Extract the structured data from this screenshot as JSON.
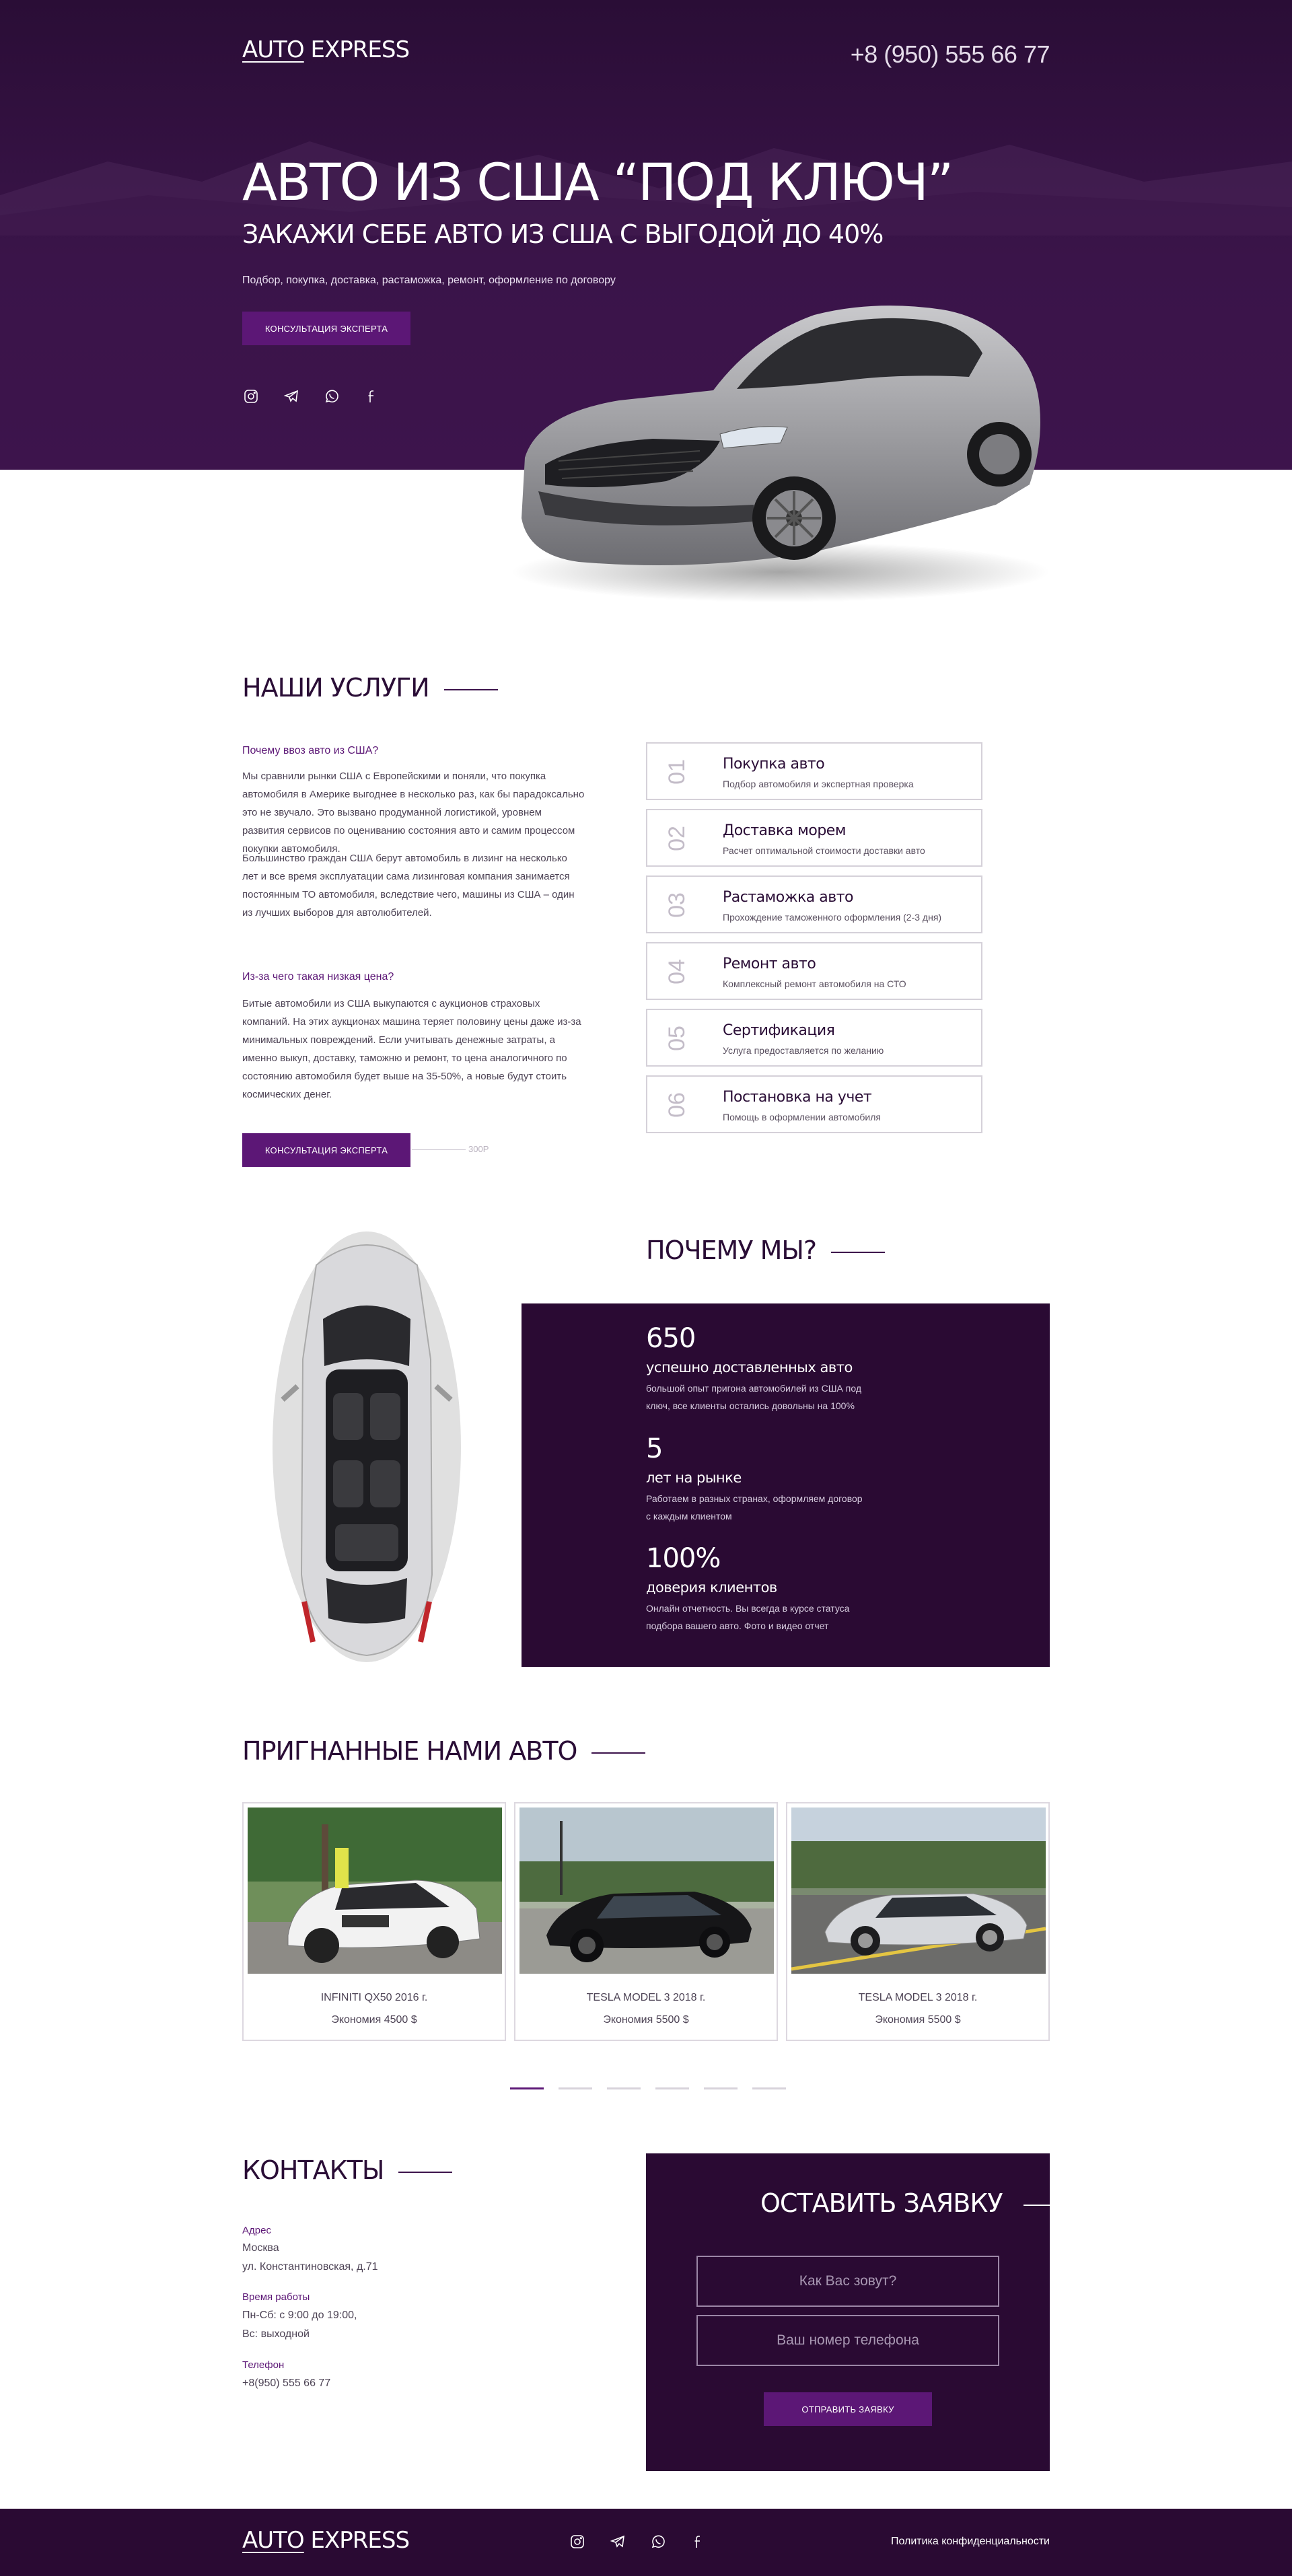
{
  "header": {
    "logo_auto": "AUTO",
    "logo_express": "EXPRESS",
    "phone": "+8 (950) 555 66 77"
  },
  "hero": {
    "title": "АВТО ИЗ США “ПОД КЛЮЧ”",
    "subtitle": "ЗАКАЖИ СЕБЕ АВТО ИЗ США С ВЫГОДОЙ ДО 40%",
    "description": "Подбор, покупка, доставка, растаможка, ремонт, оформление по договору",
    "button_label": "КОНСУЛЬТАЦИЯ ЭКСПЕРТА",
    "social_icons": [
      "instagram-icon",
      "telegram-icon",
      "whatsapp-icon",
      "facebook-icon"
    ]
  },
  "services": {
    "title": "НАШИ УСЛУГИ",
    "question1": "Почему ввоз авто из США?",
    "paragraph1": "Мы сравнили рынки США с Европейскими и поняли, что покупка автомобиля в Америке выгоднее в несколько раз, как бы парадоксально это не звучало. Это вызвано продуманной логистикой, уровнем развития сервисов по оцениванию состояния авто и самим процессом покупки автомобиля.",
    "paragraph2": "Большинство граждан США берут автомобиль в лизинг на несколько лет и все время эксплуатации сама лизинговая компания занимается постоянным ТО автомобиля, вследствие чего, машины из США – один из лучших выборов для автолюбителей.",
    "question2": "Из-за чего такая низкая цена?",
    "paragraph3": "Битые автомобили из США выкупаются с аукционов страховых компаний. На этих аукционах машина теряет половину цены даже из-за минимальных повреждений. Если учитывать денежные затраты, а именно выкуп, доставку, таможню и ремонт, то цена аналогичного по состоянию автомобиля будет выше на 35-50%, а новые будут стоить космических денег.",
    "button_label": "КОНСУЛЬТАЦИЯ ЭКСПЕРТА",
    "button_aside": "300Р",
    "items": [
      {
        "num": "01",
        "title": "Покупка авто",
        "desc": "Подбор автомобиля и экспертная проверка"
      },
      {
        "num": "02",
        "title": "Доставка морем",
        "desc": "Расчет оптимальной стоимости доставки авто"
      },
      {
        "num": "03",
        "title": "Растаможка авто",
        "desc": "Прохождение таможенного оформления (2-3 дня)"
      },
      {
        "num": "04",
        "title": "Ремонт авто",
        "desc": "Комплексный ремонт автомобиля на СТО"
      },
      {
        "num": "05",
        "title": "Сертификация",
        "desc": "Услуга предоставляется по желанию"
      },
      {
        "num": "06",
        "title": "Постановка на учет",
        "desc": "Помощь в оформлении автомобиля"
      }
    ]
  },
  "why": {
    "title": "ПОЧЕМУ МЫ?",
    "stats": [
      {
        "value": "650",
        "title": "успешно доставленных авто",
        "desc": "большой опыт пригона автомобилей из США под ключ, все клиенты остались довольны на 100%"
      },
      {
        "value": "5",
        "title": "лет на рынке",
        "desc": "Работаем в разных странах, оформляем договор с каждым клиентом"
      },
      {
        "value": "100%",
        "title": "доверия клиентов",
        "desc": "Онлайн отчетность. Вы всегда в курсе статуса подбора вашего авто. Фото и видео отчет"
      }
    ]
  },
  "cars": {
    "title": "ПРИГНАННЫЕ НАМИ АВТО",
    "items": [
      {
        "name": "INFINITI QX50 2016 г.",
        "saving": "Экономия 4500 $"
      },
      {
        "name": "TESLA MODEL 3 2018 г.",
        "saving": "Экономия 5500 $"
      },
      {
        "name": "TESLA MODEL 3 2018 г.",
        "saving": "Экономия 5500 $"
      }
    ],
    "active_slide": 1,
    "slide_count": 6
  },
  "contacts": {
    "title": "КОНТАКТЫ",
    "address_label": "Адрес",
    "address_line1": "Москва",
    "address_line2": "ул. Константиновская, д.71",
    "hours_label": "Время работы",
    "hours_line1": "Пн-Сб: с 9:00 до 19:00,",
    "hours_line2": "Вс: выходной",
    "phone_label": "Телефон",
    "phone_value": "+8(950) 555 66 77"
  },
  "form": {
    "title": "ОСТАВИТЬ ЗАЯВКУ",
    "name_placeholder": "Как Вас зовут?",
    "phone_placeholder": "Ваш номер телефона",
    "submit_label": "ОТПРАВИТЬ ЗАЯВКУ"
  },
  "footer": {
    "logo_auto": "AUTO",
    "logo_express": "EXPRESS",
    "policy": "Политика конфиденциальности"
  },
  "colors": {
    "brand_dark": "#2a0a33",
    "accent": "#5c1776",
    "border": "#d5d1d9"
  }
}
